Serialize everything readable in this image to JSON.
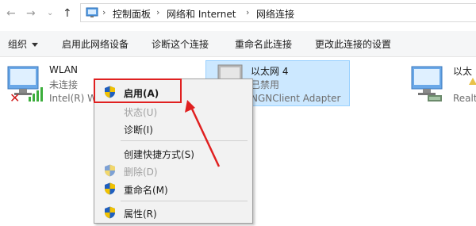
{
  "breadcrumb": {
    "items": [
      "控制面板",
      "网络和 Internet",
      "网络连接"
    ],
    "separator": "›"
  },
  "toolbar": {
    "organize": "组织",
    "enable_device": "启用此网络设备",
    "diagnose": "诊断这个连接",
    "rename": "重命名此连接",
    "change_settings": "更改此连接的设置"
  },
  "adapters": [
    {
      "name": "WLAN",
      "status": "未连接",
      "device": "Intel(R) W"
    },
    {
      "name": "以太网 4",
      "status": "已禁用",
      "device": "NGNClient Adapter"
    },
    {
      "name": "以太",
      "status": "",
      "device": "Realt"
    }
  ],
  "context_menu": {
    "enable": "启用(A)",
    "status": "状态(U)",
    "diagnose": "诊断(I)",
    "create_shortcut": "创建快捷方式(S)",
    "delete": "删除(D)",
    "rename": "重命名(M)",
    "properties": "属性(R)"
  },
  "colors": {
    "selection": "#cce8ff",
    "annotation": "#e02020",
    "shield_blue": "#1f5fbf",
    "shield_yellow": "#f2c200"
  }
}
